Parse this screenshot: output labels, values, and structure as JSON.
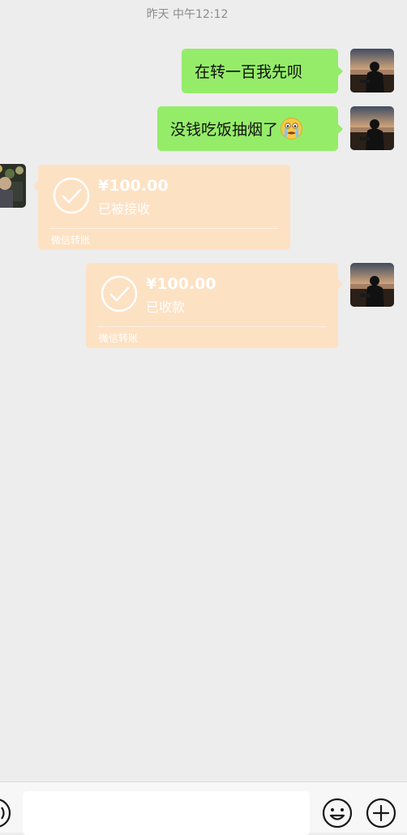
{
  "timestamp": "昨天 中午12:12",
  "messages": [
    {
      "type": "text",
      "sender": "me",
      "text": "在转一百我先呗"
    },
    {
      "type": "text",
      "sender": "me",
      "text": "没钱吃饭抽烟了",
      "emoji": "crying-face-emoji"
    },
    {
      "type": "transfer",
      "sender": "other",
      "amount": "¥100.00",
      "status": "已被接收",
      "label": "微信转账"
    },
    {
      "type": "transfer",
      "sender": "me",
      "amount": "¥100.00",
      "status": "已收款",
      "label": "微信转账"
    }
  ],
  "input_bar": {
    "value": "",
    "icons": [
      "voice-icon",
      "emoji-icon",
      "plus-icon"
    ]
  },
  "colors": {
    "background": "#ededed",
    "sent_bubble": "#95ec69",
    "transfer_card": "#fde1c3"
  }
}
